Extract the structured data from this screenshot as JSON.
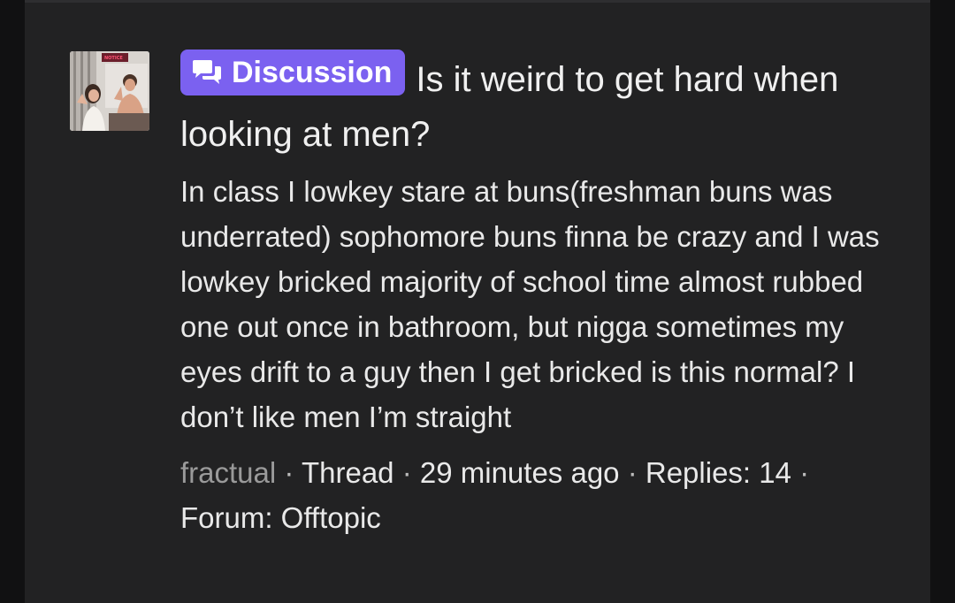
{
  "post": {
    "badge": "Discussion",
    "title": "Is it weird to get hard when looking at men?",
    "body": "In class I lowkey stare at buns(freshman buns was underrated) sophomore buns finna be crazy and I was lowkey bricked majority of school time almost rubbed one out once in bathroom, but nigga sometimes my eyes drift to a guy then I get bricked is this normal? I don’t like men I’m straight",
    "author": "fractual",
    "type": "Thread",
    "time": "29 minutes ago",
    "replies_label": "Replies: 14",
    "forum_label": "Forum: Offtopic"
  },
  "avatar": {
    "sign_text": "NOTICE"
  },
  "colors": {
    "page_bg": "#111112",
    "card_bg": "#222223",
    "badge_bg": "#7b61f0",
    "author": "#9a9a9a"
  },
  "icons": {
    "badge_icon": "chat-bubbles-icon"
  }
}
